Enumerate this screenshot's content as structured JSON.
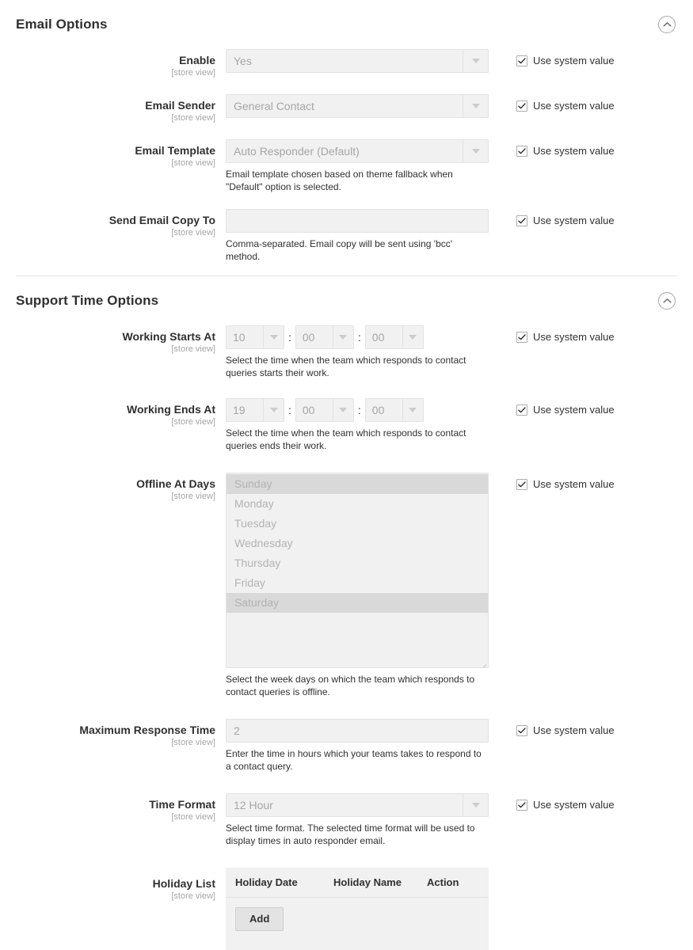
{
  "sections": [
    {
      "title": "Email Options",
      "collapse_icon": "chevron-up-circle-icon",
      "fields": [
        {
          "label": "Enable",
          "scope": "[store view]",
          "type": "select",
          "value": "Yes",
          "hint": "",
          "system_value_label": "Use system value",
          "system_value_checked": true
        },
        {
          "label": "Email Sender",
          "scope": "[store view]",
          "type": "select",
          "value": "General Contact",
          "hint": "",
          "system_value_label": "Use system value",
          "system_value_checked": true
        },
        {
          "label": "Email Template",
          "scope": "[store view]",
          "type": "select",
          "value": "Auto Responder (Default)",
          "hint": "Email template chosen based on theme fallback when \"Default\" option is selected.",
          "system_value_label": "Use system value",
          "system_value_checked": true
        },
        {
          "label": "Send Email Copy To",
          "scope": "[store view]",
          "type": "text",
          "value": "",
          "hint": "Comma-separated. Email copy will be sent using 'bcc' method.",
          "system_value_label": "Use system value",
          "system_value_checked": true
        }
      ]
    },
    {
      "title": "Support Time Options",
      "collapse_icon": "chevron-up-circle-icon",
      "fields": [
        {
          "label": "Working Starts At",
          "scope": "[store view]",
          "type": "time",
          "time_parts": [
            "10",
            "00",
            "00"
          ],
          "separator": ":",
          "hint": "Select the time when the team which responds to contact queries starts their work.",
          "system_value_label": "Use system value",
          "system_value_checked": true
        },
        {
          "label": "Working Ends At",
          "scope": "[store view]",
          "type": "time",
          "time_parts": [
            "19",
            "00",
            "00"
          ],
          "separator": ":",
          "hint": "Select the time when the team which responds to contact queries ends their work.",
          "system_value_label": "Use system value",
          "system_value_checked": true
        },
        {
          "label": "Offline At Days",
          "scope": "[store view]",
          "type": "multiselect",
          "options": [
            {
              "label": "Sunday",
              "selected": true
            },
            {
              "label": "Monday",
              "selected": false
            },
            {
              "label": "Tuesday",
              "selected": false
            },
            {
              "label": "Wednesday",
              "selected": false
            },
            {
              "label": "Thursday",
              "selected": false
            },
            {
              "label": "Friday",
              "selected": false
            },
            {
              "label": "Saturday",
              "selected": true
            }
          ],
          "hint": "Select the week days on which the team which responds to contact queries is offline.",
          "system_value_label": "Use system value",
          "system_value_checked": true
        },
        {
          "label": "Maximum Response Time",
          "scope": "[store view]",
          "type": "text",
          "value": "2",
          "hint": "Enter the time in hours which your teams takes to respond to a contact query.",
          "system_value_label": "Use system value",
          "system_value_checked": true
        },
        {
          "label": "Time Format",
          "scope": "[store view]",
          "type": "select",
          "value": "12 Hour",
          "hint": "Select time format. The selected time format will be used to display times in auto responder email.",
          "system_value_label": "Use system value",
          "system_value_checked": true
        },
        {
          "label": "Holiday List",
          "scope": "[store view]",
          "type": "table",
          "columns": [
            "Holiday Date",
            "Holiday Name",
            "Action"
          ],
          "rows": [],
          "add_button_label": "Add"
        }
      ]
    }
  ]
}
